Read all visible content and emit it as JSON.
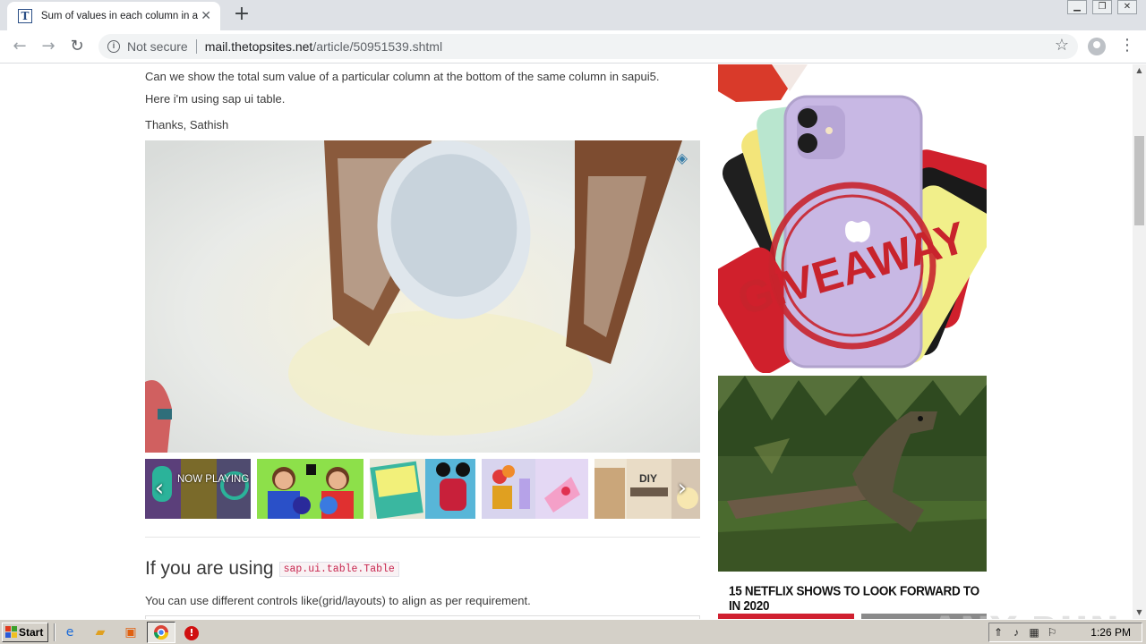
{
  "browser": {
    "tab_title": "Sum of values in each column in a table",
    "tab_favicon": "T",
    "new_tab": "+",
    "close": "✕",
    "url_security": "Not secure",
    "url_host": "mail.thetopsites.net",
    "url_path": "/article/50951539.shtml"
  },
  "article": {
    "question_line1": "Can we show the total sum value of a particular column at the bottom of the same column in sapui5.",
    "question_line2": "Here i'm using sap ui table.",
    "thanks": "Thanks, Sathish",
    "now_playing": "NOW PLAYING",
    "answer_heading": "If you are using",
    "answer_code": "sap.ui.table.Table",
    "answer_text": "You can use different controls like(grid/layouts) to align as per requirement."
  },
  "sidebar": {
    "ad1_stamp": "GIVEAWAY",
    "ad2_caption": "15 NETFLIX SHOWS TO LOOK FORWARD TO IN 2020"
  },
  "watermark": "ANY RUN",
  "taskbar": {
    "start_label": "Start",
    "clock": "1:26 PM"
  },
  "colors": {
    "video_bg": "#e6e8e6",
    "giveaway_red": "#c8232c",
    "taskbar_bg": "#d4d0c8"
  }
}
